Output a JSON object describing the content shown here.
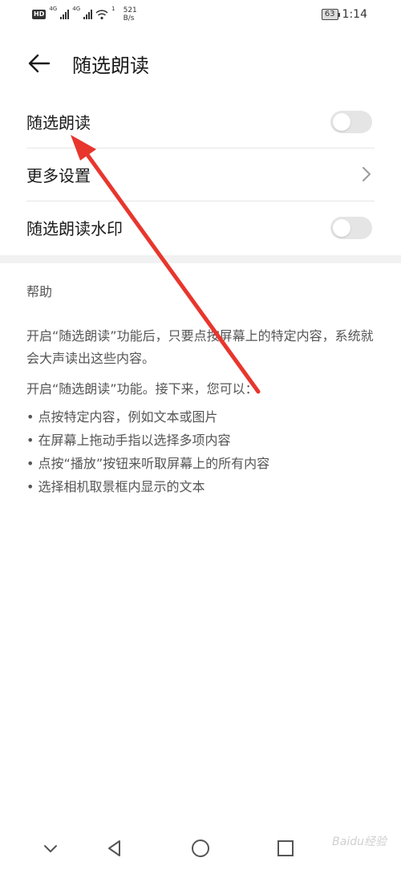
{
  "status_bar": {
    "hd": "HD",
    "net1": "4G",
    "net2": "4G",
    "wifi_badge": "1",
    "speed_value": "521",
    "speed_unit": "B/s",
    "battery": "63",
    "time": "1:14"
  },
  "header": {
    "title": "随选朗读"
  },
  "settings": {
    "toggle_read": {
      "label": "随选朗读",
      "on": false
    },
    "more_settings": {
      "label": "更多设置"
    },
    "toggle_watermark": {
      "label": "随选朗读水印",
      "on": false
    }
  },
  "help": {
    "title": "帮助",
    "p1": "开启“随选朗读”功能后，只要点按屏幕上的特定内容，系统就会大声读出这些内容。",
    "p2": "开启“随选朗读”功能。接下来，您可以：",
    "bullets": [
      "点按特定内容，例如文本或图片",
      "在屏幕上拖动手指以选择多项内容",
      "点按“播放”按钮来听取屏幕上的所有内容",
      "选择相机取景框内显示的文本"
    ]
  },
  "watermark": "Baidu经验",
  "colors": {
    "switch_off": "#e5e5e5",
    "annotation_arrow": "#e8362d",
    "text_primary": "#1a1a1a",
    "text_secondary": "#555555"
  }
}
